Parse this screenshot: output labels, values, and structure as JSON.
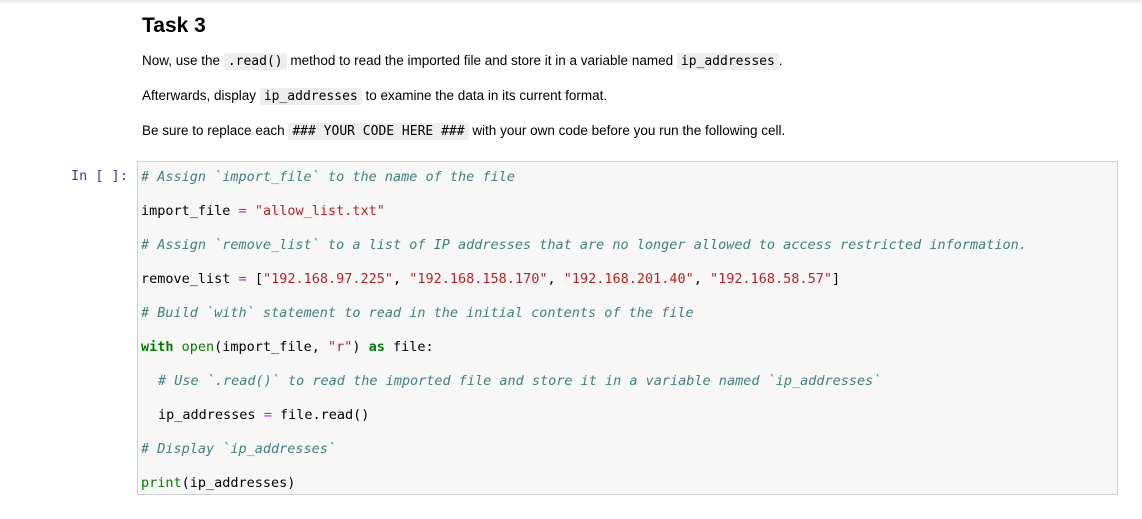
{
  "markdown": {
    "title": "Task 3",
    "p1": {
      "before": "Now, use the",
      "code1": ".read()",
      "middle": "method to read the imported file and store it in a variable named",
      "code2": "ip_addresses",
      "after": "."
    },
    "p2": {
      "before": "Afterwards, display",
      "code": "ip_addresses",
      "after": "to examine the data in its current format."
    },
    "p3": {
      "before": "Be sure to replace each",
      "code": "### YOUR CODE HERE ###",
      "after": "with your own code before you run the following cell."
    }
  },
  "cell": {
    "prompt": "In [ ]:",
    "comment1": "# Assign `import_file` to the name of the file",
    "line2": {
      "var": "import_file",
      "eq": "=",
      "value": "\"allow_list.txt\""
    },
    "comment3": "# Assign `remove_list` to a list of IP addresses that are no longer allowed to access restricted information.",
    "line4": {
      "var": "remove_list",
      "eq": "=",
      "open": "[",
      "ip1": "\"192.168.97.225\"",
      "ip2": "\"192.168.158.170\"",
      "ip3": "\"192.168.201.40\"",
      "ip4": "\"192.168.58.57\"",
      "close": "]",
      "sep": ", "
    },
    "comment5": "# Build `with` statement to read in the initial contents of the file",
    "line6": {
      "kw_with": "with",
      "fn_open": "open",
      "args_start": "(import_file, ",
      "mode": "\"r\"",
      "args_end": ") ",
      "kw_as": "as",
      "rest": " file:"
    },
    "comment7": "# Use `.read()` to read the imported file and store it in a variable named `ip_addresses`",
    "line8": {
      "var": "ip_addresses",
      "eq": "=",
      "rhs": "file.read()"
    },
    "comment9": "# Display `ip_addresses`",
    "line10": {
      "fn_print": "print",
      "args": "(ip_addresses)"
    }
  }
}
